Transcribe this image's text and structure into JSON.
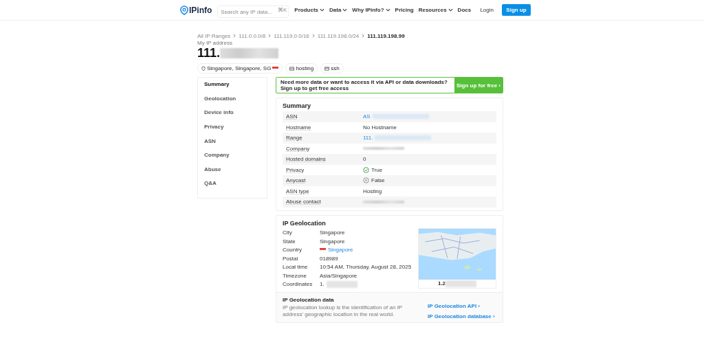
{
  "header": {
    "logo": "IPinfo",
    "search": {
      "placeholder": "Search any IP data...",
      "shortcut": "⌘K"
    },
    "nav": [
      {
        "label": "Products",
        "dropdown": true
      },
      {
        "label": "Data",
        "dropdown": true
      },
      {
        "label": "Why IPinfo?",
        "dropdown": true
      },
      {
        "label": "Pricing",
        "dropdown": false
      },
      {
        "label": "Resources",
        "dropdown": true
      },
      {
        "label": "Docs",
        "dropdown": false
      }
    ],
    "login": "Login",
    "signup": "Sign up"
  },
  "breadcrumb": [
    "All IP Ranges",
    "111.0.0.0/8",
    "111.119.0.0/16",
    "111.119.198.0/24",
    "111.119.198.99"
  ],
  "subtitle": "My IP address",
  "ip": "111.",
  "tags": [
    {
      "kind": "location",
      "label": "Singapore, Singapore, SG"
    },
    {
      "kind": "hosting",
      "label": "hosting"
    },
    {
      "kind": "ssh",
      "label": "ssh"
    }
  ],
  "sidebar": [
    {
      "label": "Summary",
      "selected": true
    },
    {
      "label": "Geolocation",
      "selected": false
    },
    {
      "label": "Device info",
      "selected": false
    },
    {
      "label": "Privacy",
      "selected": false
    },
    {
      "label": "ASN",
      "selected": false
    },
    {
      "label": "Company",
      "selected": false
    },
    {
      "label": "Abuse",
      "selected": false
    },
    {
      "label": "Q&A",
      "selected": false
    }
  ],
  "banner": {
    "text": "Need more data or want to access it via API or data downloads? Sign up to get free access",
    "button": "Sign up for free ›"
  },
  "summary": {
    "title": "Summary",
    "rows": [
      {
        "label": "ASN",
        "kind": "link",
        "value": "AS"
      },
      {
        "label": "Hostname",
        "kind": "text",
        "value": "No Hostname"
      },
      {
        "label": "Range",
        "kind": "link",
        "value": "111."
      },
      {
        "label": "Company",
        "kind": "redacted"
      },
      {
        "label": "Hosted domains",
        "kind": "text",
        "value": "0"
      },
      {
        "label": "Privacy",
        "kind": "bool",
        "on": true,
        "value": "True"
      },
      {
        "label": "Anycast",
        "kind": "bool",
        "on": false,
        "value": "False"
      },
      {
        "label": "ASN type",
        "kind": "text",
        "value": "Hosting"
      },
      {
        "label": "Abuse contact",
        "kind": "redacted"
      }
    ]
  },
  "geolocation": {
    "title": "IP Geolocation",
    "rows": [
      {
        "label": "City",
        "kind": "text",
        "value": "Singapore"
      },
      {
        "label": "State",
        "kind": "text",
        "value": "Singapore"
      },
      {
        "label": "Country",
        "kind": "country",
        "value": "Singapore"
      },
      {
        "label": "Postal",
        "kind": "text",
        "value": "018989"
      },
      {
        "label": "Local time",
        "kind": "text",
        "value": "10:54 AM, Thursday, August 28, 2025"
      },
      {
        "label": "Timezone",
        "kind": "text",
        "value": "Asia/Singapore"
      },
      {
        "label": "Coordinates",
        "kind": "redacted",
        "value": "1."
      }
    ],
    "map_caption": "1.2"
  },
  "geo_data": {
    "title": "IP Geolocation data",
    "text": "IP geolocation lookup is the identification of an IP address' geographic location in the real world.",
    "links": [
      "IP Geolocation API ›",
      "IP Geolocation database ›"
    ]
  }
}
